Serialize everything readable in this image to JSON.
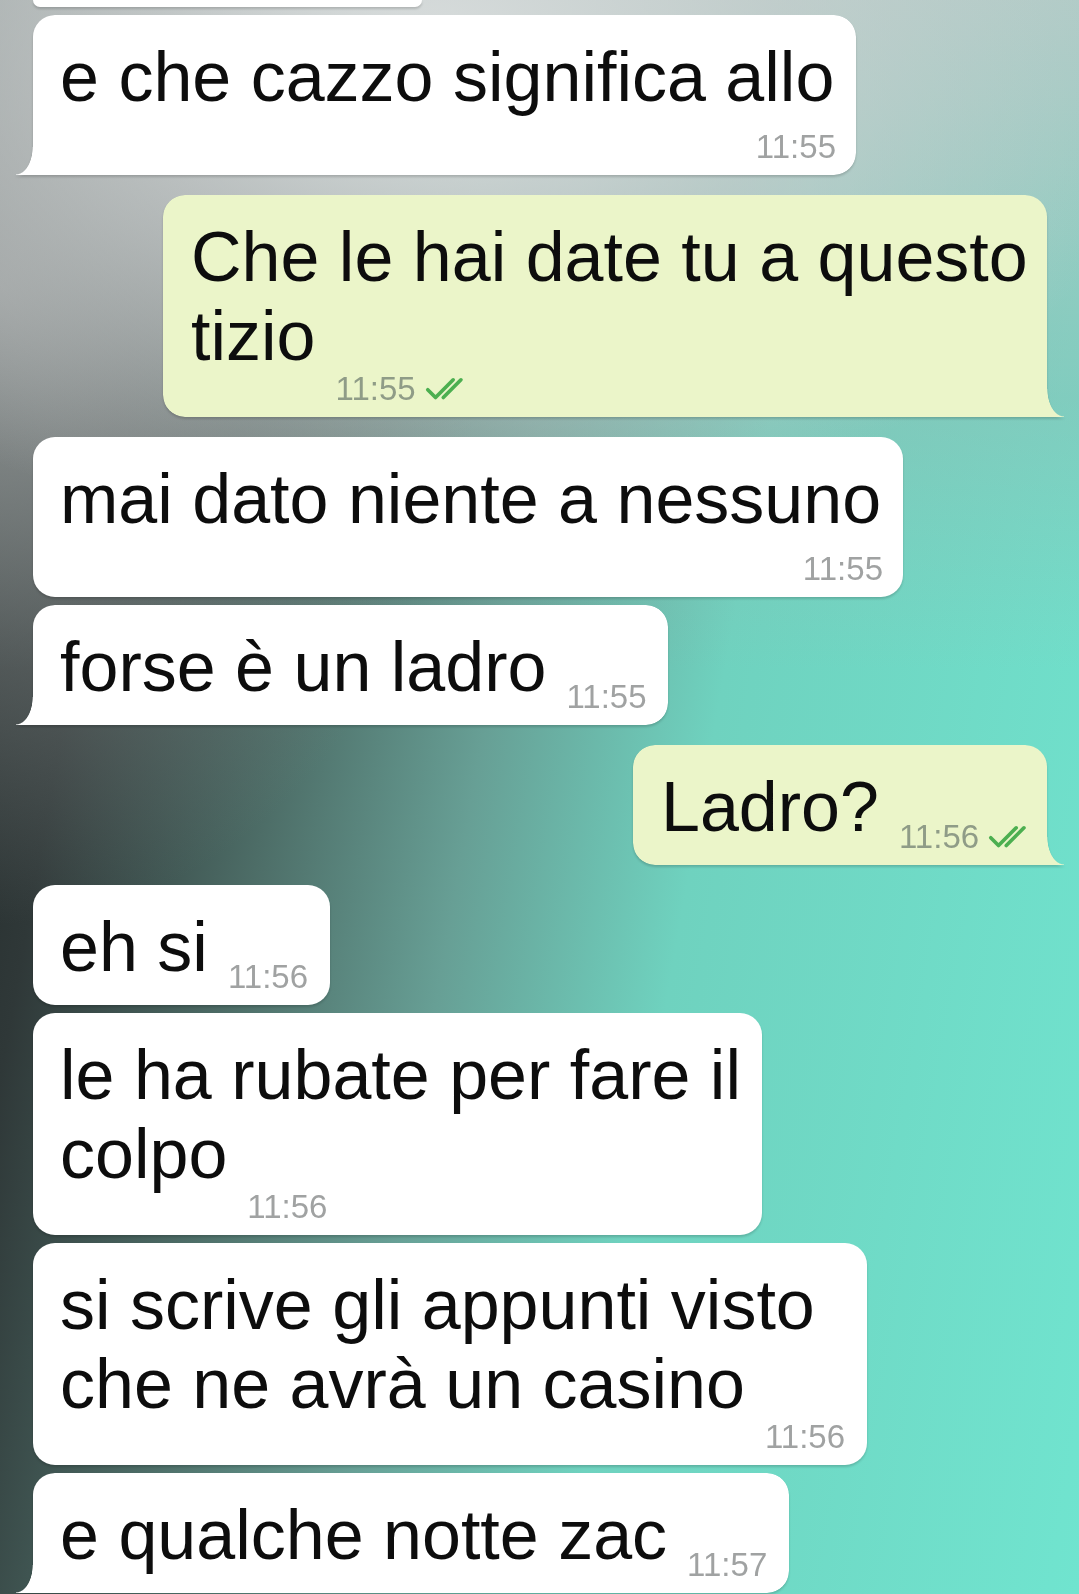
{
  "top_cut_bubble": {
    "kind": "incoming"
  },
  "messages": [
    {
      "kind": "incoming",
      "text": "e che cazzo significa allo",
      "time": "11:55",
      "tail": true
    },
    {
      "kind": "outgoing",
      "text": "Che le hai date tu a questo tizio",
      "time": "11:55",
      "delivered": true,
      "tail": true
    },
    {
      "kind": "incoming",
      "text": "mai dato niente a nessuno",
      "time": "11:55",
      "tail": false
    },
    {
      "kind": "incoming",
      "text": "forse è un ladro",
      "time": "11:55",
      "tail": true
    },
    {
      "kind": "outgoing",
      "text": "Ladro?",
      "time": "11:56",
      "delivered": true,
      "tail": true
    },
    {
      "kind": "incoming",
      "text": "eh si",
      "time": "11:56",
      "tail": false
    },
    {
      "kind": "incoming",
      "text": "le ha rubate per fare il colpo",
      "time": "11:56",
      "tail": false
    },
    {
      "kind": "incoming",
      "text": "si scrive gli appunti visto che ne avrà un casino",
      "time": "11:56",
      "tail": false
    },
    {
      "kind": "incoming",
      "text": "e qualche notte zac",
      "time": "11:57",
      "tail": true
    }
  ]
}
